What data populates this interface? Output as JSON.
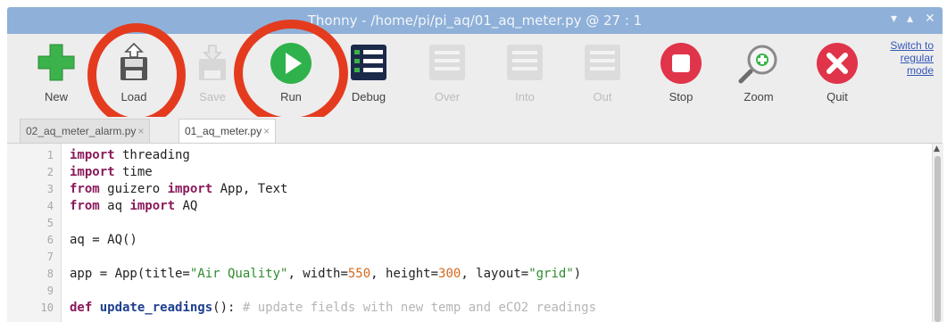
{
  "window": {
    "title": "Thonny - /home/pi/pi_aq/01_aq_meter.py @ 27 : 1",
    "controls": [
      "minimize",
      "maximize",
      "close"
    ]
  },
  "toolbar": {
    "buttons": [
      {
        "label": "New",
        "icon": "new-icon",
        "enabled": true
      },
      {
        "label": "Load",
        "icon": "load-icon",
        "enabled": true,
        "highlighted": true
      },
      {
        "label": "Save",
        "icon": "save-icon",
        "enabled": false
      },
      {
        "label": "Run",
        "icon": "run-icon",
        "enabled": true,
        "highlighted": true
      },
      {
        "label": "Debug",
        "icon": "debug-icon",
        "enabled": true
      },
      {
        "label": "Over",
        "icon": "step-over-icon",
        "enabled": false
      },
      {
        "label": "Into",
        "icon": "step-into-icon",
        "enabled": false
      },
      {
        "label": "Out",
        "icon": "step-out-icon",
        "enabled": false
      },
      {
        "label": "Stop",
        "icon": "stop-icon",
        "enabled": true
      },
      {
        "label": "Zoom",
        "icon": "zoom-icon",
        "enabled": true
      },
      {
        "label": "Quit",
        "icon": "quit-icon",
        "enabled": true
      }
    ],
    "switch_mode": {
      "line1": "Switch to",
      "line2": "regular",
      "line3": "mode"
    }
  },
  "tabs": [
    {
      "label": "02_aq_meter_alarm.py",
      "close": "×",
      "active": false
    },
    {
      "label": "01_aq_meter.py",
      "close": "×",
      "active": true
    }
  ],
  "editor": {
    "line_numbers": [
      "1",
      "2",
      "3",
      "4",
      "5",
      "6",
      "7",
      "8",
      "9",
      "10"
    ],
    "lines": [
      "import threading",
      "import time",
      "from guizero import App, Text",
      "from aq import AQ",
      "",
      "aq = AQ()",
      "",
      "app = App(title=\"Air Quality\", width=550, height=300, layout=\"grid\")",
      "",
      "def update_readings(): # update fields with new temp and eCO2 readings"
    ]
  },
  "colors": {
    "titlebar": "#8fb0d8",
    "highlight_ring": "#e43b1f",
    "new_icon": "#3bb34a",
    "run_icon": "#2fb24b",
    "stop_icon": "#e0344a",
    "quit_icon": "#e0344a",
    "keyword": "#8a1a5b",
    "string": "#2e8b2e",
    "number": "#d2691e",
    "comment": "#b5b5b5"
  }
}
